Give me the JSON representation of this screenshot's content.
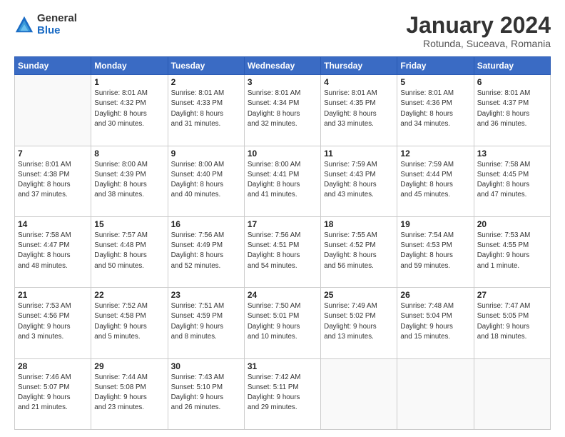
{
  "header": {
    "logo_general": "General",
    "logo_blue": "Blue",
    "title": "January 2024",
    "subtitle": "Rotunda, Suceava, Romania"
  },
  "days_of_week": [
    "Sunday",
    "Monday",
    "Tuesday",
    "Wednesday",
    "Thursday",
    "Friday",
    "Saturday"
  ],
  "weeks": [
    [
      {
        "day": "",
        "info": ""
      },
      {
        "day": "1",
        "info": "Sunrise: 8:01 AM\nSunset: 4:32 PM\nDaylight: 8 hours\nand 30 minutes."
      },
      {
        "day": "2",
        "info": "Sunrise: 8:01 AM\nSunset: 4:33 PM\nDaylight: 8 hours\nand 31 minutes."
      },
      {
        "day": "3",
        "info": "Sunrise: 8:01 AM\nSunset: 4:34 PM\nDaylight: 8 hours\nand 32 minutes."
      },
      {
        "day": "4",
        "info": "Sunrise: 8:01 AM\nSunset: 4:35 PM\nDaylight: 8 hours\nand 33 minutes."
      },
      {
        "day": "5",
        "info": "Sunrise: 8:01 AM\nSunset: 4:36 PM\nDaylight: 8 hours\nand 34 minutes."
      },
      {
        "day": "6",
        "info": "Sunrise: 8:01 AM\nSunset: 4:37 PM\nDaylight: 8 hours\nand 36 minutes."
      }
    ],
    [
      {
        "day": "7",
        "info": "Sunrise: 8:01 AM\nSunset: 4:38 PM\nDaylight: 8 hours\nand 37 minutes."
      },
      {
        "day": "8",
        "info": "Sunrise: 8:00 AM\nSunset: 4:39 PM\nDaylight: 8 hours\nand 38 minutes."
      },
      {
        "day": "9",
        "info": "Sunrise: 8:00 AM\nSunset: 4:40 PM\nDaylight: 8 hours\nand 40 minutes."
      },
      {
        "day": "10",
        "info": "Sunrise: 8:00 AM\nSunset: 4:41 PM\nDaylight: 8 hours\nand 41 minutes."
      },
      {
        "day": "11",
        "info": "Sunrise: 7:59 AM\nSunset: 4:43 PM\nDaylight: 8 hours\nand 43 minutes."
      },
      {
        "day": "12",
        "info": "Sunrise: 7:59 AM\nSunset: 4:44 PM\nDaylight: 8 hours\nand 45 minutes."
      },
      {
        "day": "13",
        "info": "Sunrise: 7:58 AM\nSunset: 4:45 PM\nDaylight: 8 hours\nand 47 minutes."
      }
    ],
    [
      {
        "day": "14",
        "info": "Sunrise: 7:58 AM\nSunset: 4:47 PM\nDaylight: 8 hours\nand 48 minutes."
      },
      {
        "day": "15",
        "info": "Sunrise: 7:57 AM\nSunset: 4:48 PM\nDaylight: 8 hours\nand 50 minutes."
      },
      {
        "day": "16",
        "info": "Sunrise: 7:56 AM\nSunset: 4:49 PM\nDaylight: 8 hours\nand 52 minutes."
      },
      {
        "day": "17",
        "info": "Sunrise: 7:56 AM\nSunset: 4:51 PM\nDaylight: 8 hours\nand 54 minutes."
      },
      {
        "day": "18",
        "info": "Sunrise: 7:55 AM\nSunset: 4:52 PM\nDaylight: 8 hours\nand 56 minutes."
      },
      {
        "day": "19",
        "info": "Sunrise: 7:54 AM\nSunset: 4:53 PM\nDaylight: 8 hours\nand 59 minutes."
      },
      {
        "day": "20",
        "info": "Sunrise: 7:53 AM\nSunset: 4:55 PM\nDaylight: 9 hours\nand 1 minute."
      }
    ],
    [
      {
        "day": "21",
        "info": "Sunrise: 7:53 AM\nSunset: 4:56 PM\nDaylight: 9 hours\nand 3 minutes."
      },
      {
        "day": "22",
        "info": "Sunrise: 7:52 AM\nSunset: 4:58 PM\nDaylight: 9 hours\nand 5 minutes."
      },
      {
        "day": "23",
        "info": "Sunrise: 7:51 AM\nSunset: 4:59 PM\nDaylight: 9 hours\nand 8 minutes."
      },
      {
        "day": "24",
        "info": "Sunrise: 7:50 AM\nSunset: 5:01 PM\nDaylight: 9 hours\nand 10 minutes."
      },
      {
        "day": "25",
        "info": "Sunrise: 7:49 AM\nSunset: 5:02 PM\nDaylight: 9 hours\nand 13 minutes."
      },
      {
        "day": "26",
        "info": "Sunrise: 7:48 AM\nSunset: 5:04 PM\nDaylight: 9 hours\nand 15 minutes."
      },
      {
        "day": "27",
        "info": "Sunrise: 7:47 AM\nSunset: 5:05 PM\nDaylight: 9 hours\nand 18 minutes."
      }
    ],
    [
      {
        "day": "28",
        "info": "Sunrise: 7:46 AM\nSunset: 5:07 PM\nDaylight: 9 hours\nand 21 minutes."
      },
      {
        "day": "29",
        "info": "Sunrise: 7:44 AM\nSunset: 5:08 PM\nDaylight: 9 hours\nand 23 minutes."
      },
      {
        "day": "30",
        "info": "Sunrise: 7:43 AM\nSunset: 5:10 PM\nDaylight: 9 hours\nand 26 minutes."
      },
      {
        "day": "31",
        "info": "Sunrise: 7:42 AM\nSunset: 5:11 PM\nDaylight: 9 hours\nand 29 minutes."
      },
      {
        "day": "",
        "info": ""
      },
      {
        "day": "",
        "info": ""
      },
      {
        "day": "",
        "info": ""
      }
    ]
  ]
}
